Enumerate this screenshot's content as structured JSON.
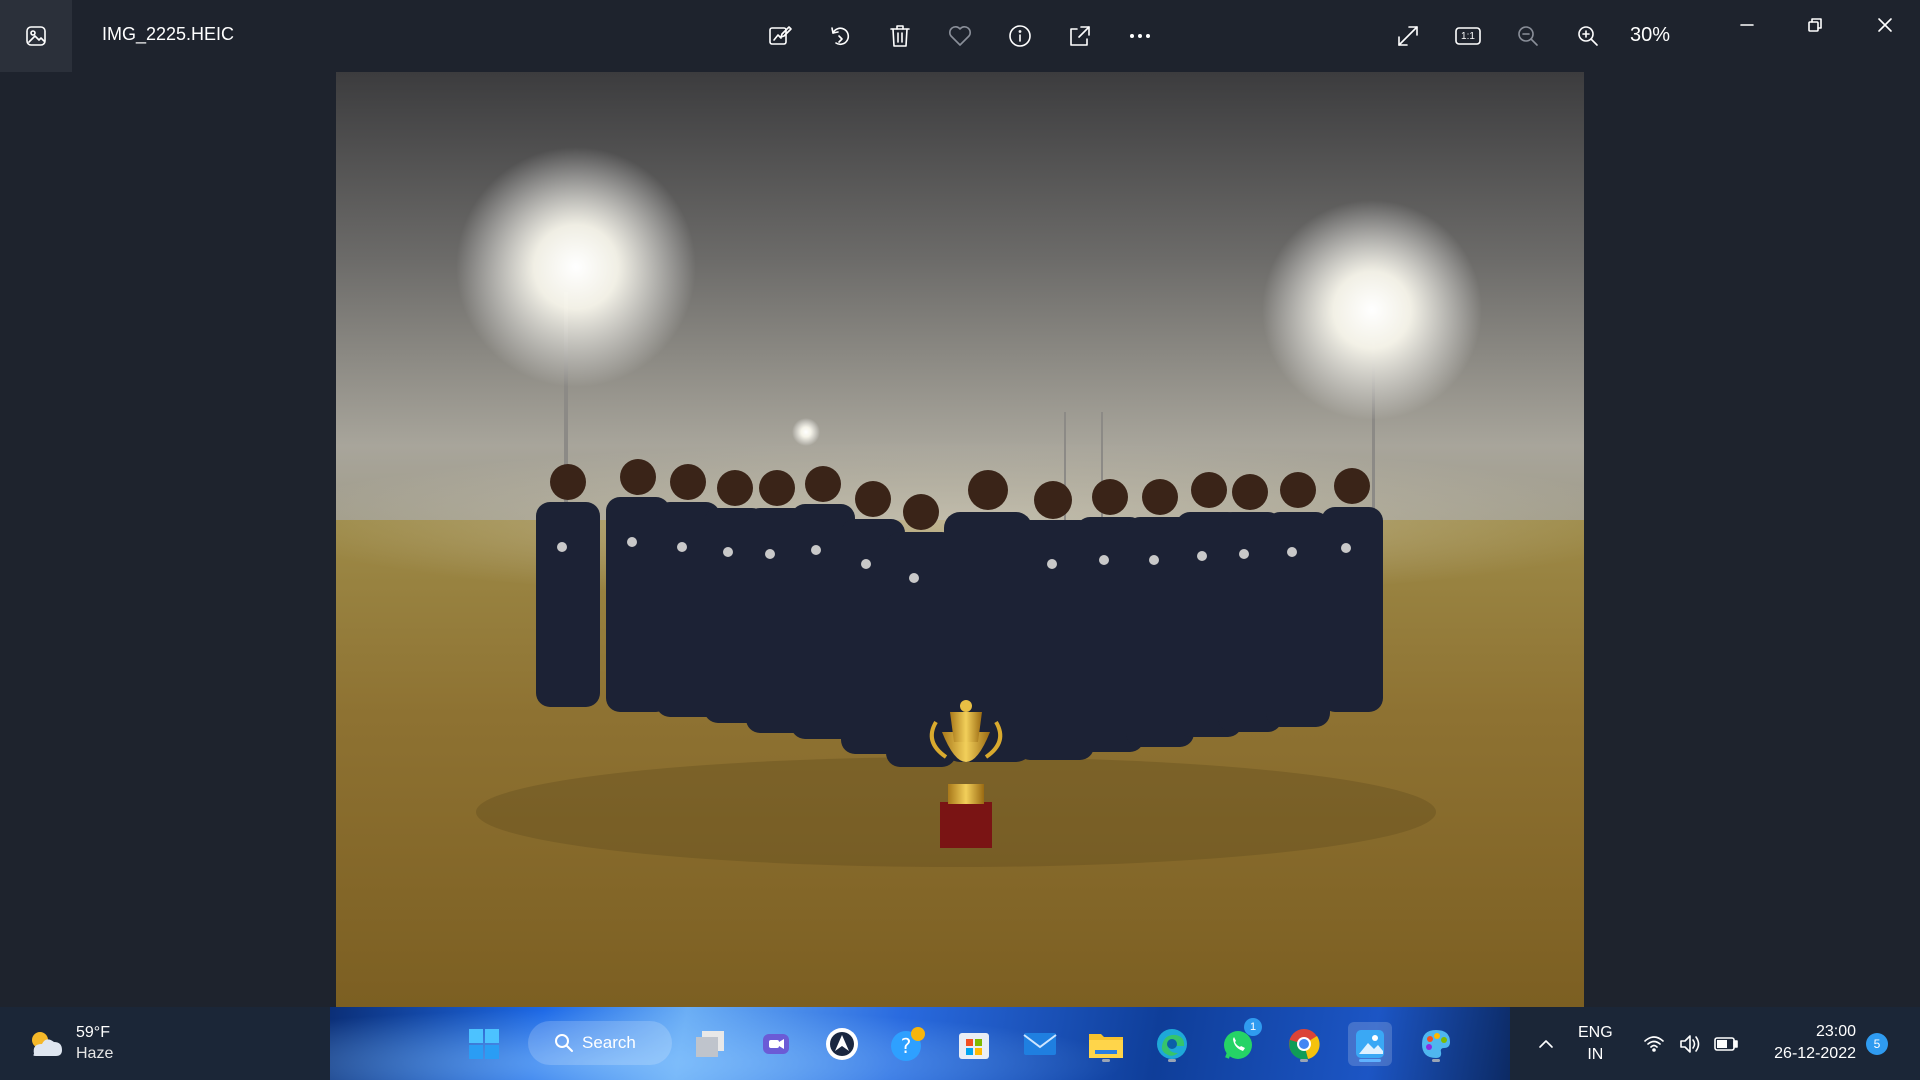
{
  "window": {
    "file_name": "IMG_2225.HEIC",
    "zoom": "30%"
  },
  "toolbar": {
    "icons": [
      "edit-image-icon",
      "rotate-icon",
      "delete-icon",
      "favorite-icon",
      "info-icon",
      "share-icon",
      "more-icon"
    ],
    "right_icons": [
      "fullscreen-icon",
      "actual-size-icon",
      "zoom-out-icon",
      "zoom-in-icon"
    ],
    "actual_size_label": "1:1"
  },
  "taskbar": {
    "weather": {
      "temp": "59°F",
      "condition": "Haze"
    },
    "search_label": "Search",
    "apps": [
      "windows-start",
      "search",
      "task-view",
      "teams-chat",
      "shield-app",
      "get-help",
      "microsoft-store",
      "mail",
      "file-explorer",
      "edge",
      "whatsapp",
      "chrome",
      "photos",
      "paint"
    ],
    "whatsapp_badge": "1",
    "language": {
      "line1": "ENG",
      "line2": "IN"
    },
    "clock": {
      "time": "23:00",
      "date": "26-12-2022"
    },
    "notification_count": "5"
  },
  "colors": {
    "window_bg": "#1e232d",
    "accent": "#2f9bf0"
  }
}
